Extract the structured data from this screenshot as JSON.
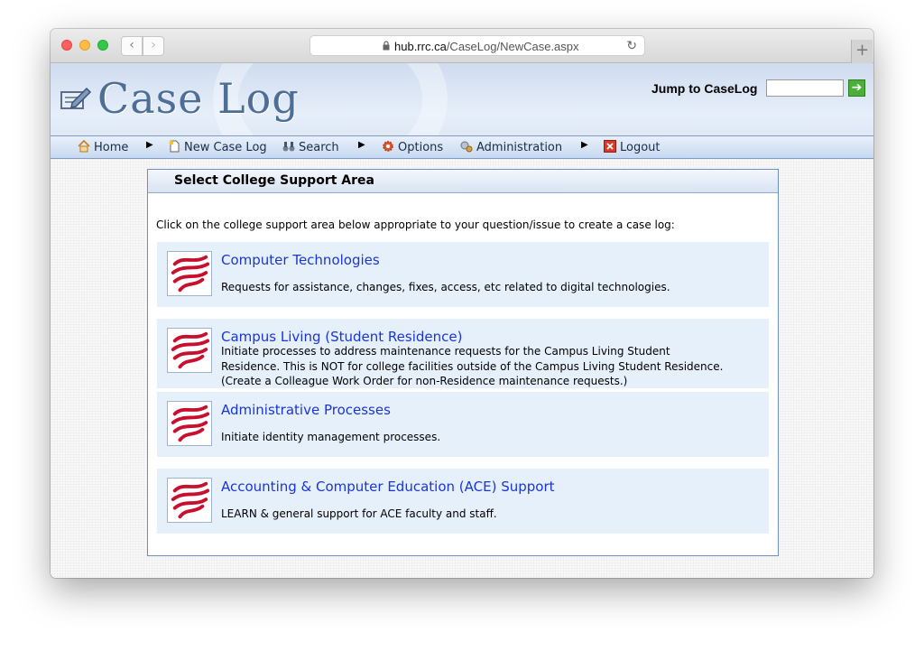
{
  "browser": {
    "url_domain": "hub.rrc.ca",
    "url_path": "/CaseLog/NewCase.aspx",
    "back_icon": "chevron-left-icon",
    "forward_icon": "chevron-right-icon",
    "reload_icon": "reload-icon",
    "newtab_label": "+"
  },
  "header": {
    "logo_text": "Case Log",
    "jump_label": "Jump to CaseLog",
    "jump_value": "",
    "go_glyph": "➔"
  },
  "menu": {
    "home": "Home",
    "new_case_log": "New Case Log",
    "search": "Search",
    "options": "Options",
    "administration": "Administration",
    "logout": "Logout"
  },
  "panel": {
    "title": "Select College Support Area",
    "intro": "Click on the college support area below appropriate to your question/issue to create a case log:"
  },
  "areas": [
    {
      "title": "Computer Technologies",
      "description": [
        "Requests for assistance, changes, fixes, access, etc related to digital technologies."
      ]
    },
    {
      "title": "Campus Living (Student Residence)",
      "description": [
        "Initiate processes to address maintenance requests for the Campus Living Student",
        "Residence. This is NOT for college facilities outside of the Campus Living Student Residence.",
        "(Create a Colleague Work Order for non-Residence maintenance requests.)"
      ]
    },
    {
      "title": "Administrative Processes",
      "description": [
        "Initiate identity management processes."
      ]
    },
    {
      "title": "Accounting & Computer Education (ACE) Support",
      "description": [
        "LEARN & general support for ACE faculty and staff."
      ]
    }
  ],
  "colors": {
    "link": "#1a35d6",
    "area_bg": "#e6f0fb",
    "logo_red": "#c8102e",
    "logo_text": "#4d6f97"
  }
}
